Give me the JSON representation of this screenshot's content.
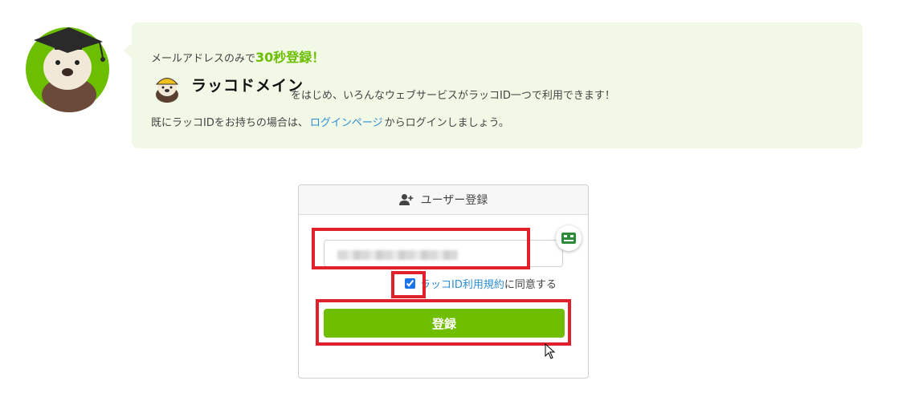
{
  "banner": {
    "line1_prefix": "メールアドレスのみで",
    "line1_highlight": "30秒登録！",
    "brand_name": "ラッコドメイン",
    "line2_text": "をはじめ、いろんなウェブサービスがラッコID一つで利用できます！",
    "line3_prefix": "既にラッコIDをお持ちの場合は、",
    "login_link": "ログインページ",
    "line3_suffix": "からログインしましょう。"
  },
  "form": {
    "header_title": "ユーザー登録",
    "email_placeholder": "",
    "terms_link": "ラッコID利用規約",
    "terms_suffix": "に同意する",
    "terms_checked": true,
    "submit_label": "登録"
  },
  "colors": {
    "accent_green": "#6fbe00",
    "bubble_bg": "#f1f8e6",
    "link_blue": "#2d8fd1",
    "highlight_red": "#e0202a"
  },
  "icons": {
    "mascot": "sea-otter-graduate-icon",
    "brand": "sea-otter-helmet-icon",
    "header": "user-plus-icon",
    "side_badge": "card-icon",
    "pointer": "cursor-icon"
  }
}
